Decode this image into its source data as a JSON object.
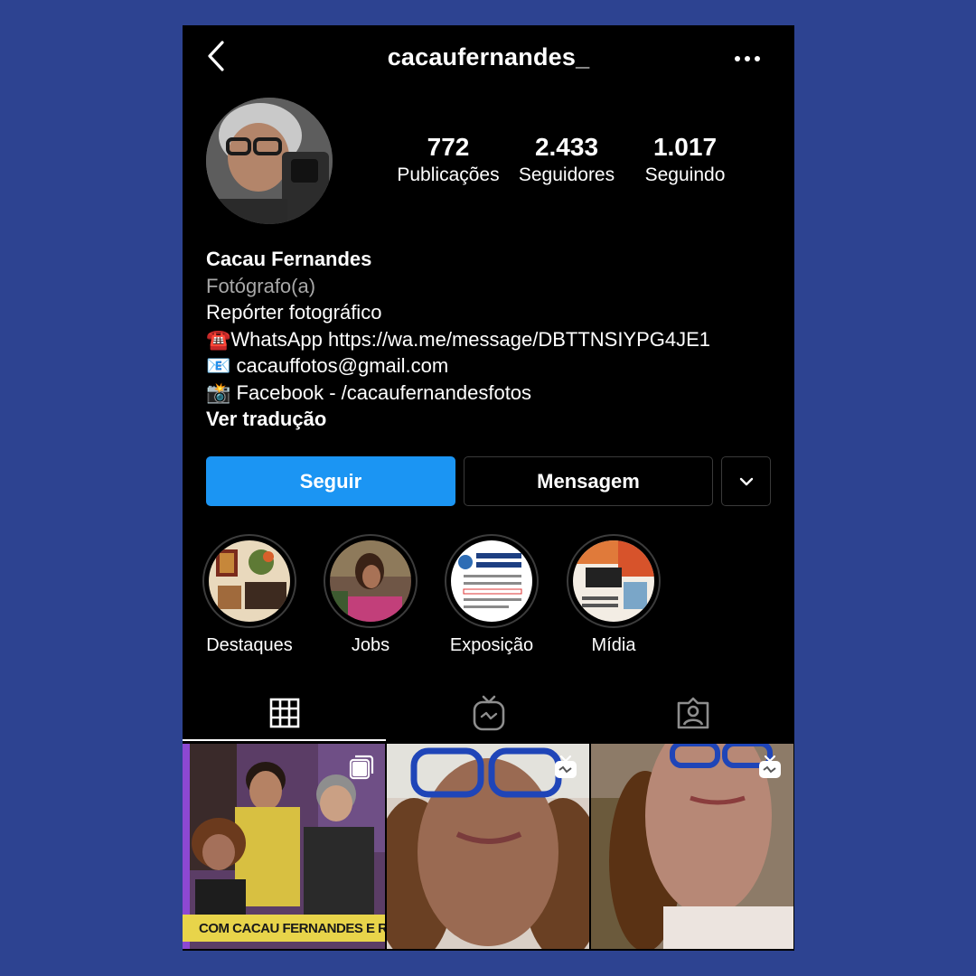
{
  "header": {
    "username": "cacaufernandes_",
    "back_icon": "chevron-left-icon",
    "more_icon": "more-horizontal-icon"
  },
  "stats": [
    {
      "value": "772",
      "label": "Publicações"
    },
    {
      "value": "2.433",
      "label": "Seguidores"
    },
    {
      "value": "1.017",
      "label": "Seguindo"
    }
  ],
  "bio": {
    "name": "Cacau Fernandes",
    "category": "Fotógrafo(a)",
    "lines": [
      "Repórter fotográfico",
      "☎️WhatsApp https://wa.me/message/DBTTNSIYPG4JE1",
      "📧 cacauffotos@gmail.com",
      "📸 Facebook - /cacaufernandesfotos"
    ],
    "translate": "Ver tradução"
  },
  "actions": {
    "follow": "Seguir",
    "message": "Mensagem",
    "more_icon": "chevron-down-icon"
  },
  "highlights": [
    {
      "label": "Destaques"
    },
    {
      "label": "Jobs"
    },
    {
      "label": "Exposição"
    },
    {
      "label": "Mídia"
    }
  ],
  "tabs": [
    {
      "icon": "grid-icon",
      "active": true
    },
    {
      "icon": "igtv-icon",
      "active": false
    },
    {
      "icon": "tagged-icon",
      "active": false
    }
  ],
  "posts": [
    {
      "badge": "multiple-posts-icon",
      "caption": "COM CACAU FERNANDES E RODR"
    },
    {
      "badge": "igtv-icon"
    },
    {
      "badge": "igtv-icon"
    }
  ],
  "colors": {
    "background": "#2d4391",
    "screen": "#000000",
    "primary": "#1b95f3"
  }
}
